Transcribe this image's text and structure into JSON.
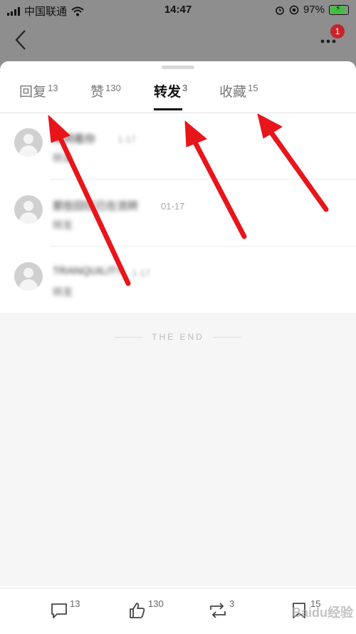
{
  "status_bar": {
    "carrier": "中国联通",
    "time": "14:47",
    "battery": "97%"
  },
  "header": {
    "badge_count": "1"
  },
  "tabs": [
    {
      "label": "回复",
      "count": "13"
    },
    {
      "label": "赞",
      "count": "130"
    },
    {
      "label": "转发",
      "count": "3"
    },
    {
      "label": "收藏",
      "count": "15"
    }
  ],
  "list": [
    {
      "name": "宋明看你",
      "date": "1-17",
      "sub": "转发"
    },
    {
      "name": "那些回忆已在流转",
      "date": "01-17",
      "sub": "转发"
    },
    {
      "name": "TRANQUILITY",
      "date": "1-17",
      "sub": "转发"
    }
  ],
  "the_end": "THE END",
  "toolbar": {
    "comments": "13",
    "likes": "130",
    "reposts": "3",
    "favorites": "15"
  },
  "watermark": "Baidu经验",
  "colors": {
    "arrow": "#e8151b",
    "badge": "#c8232c"
  }
}
